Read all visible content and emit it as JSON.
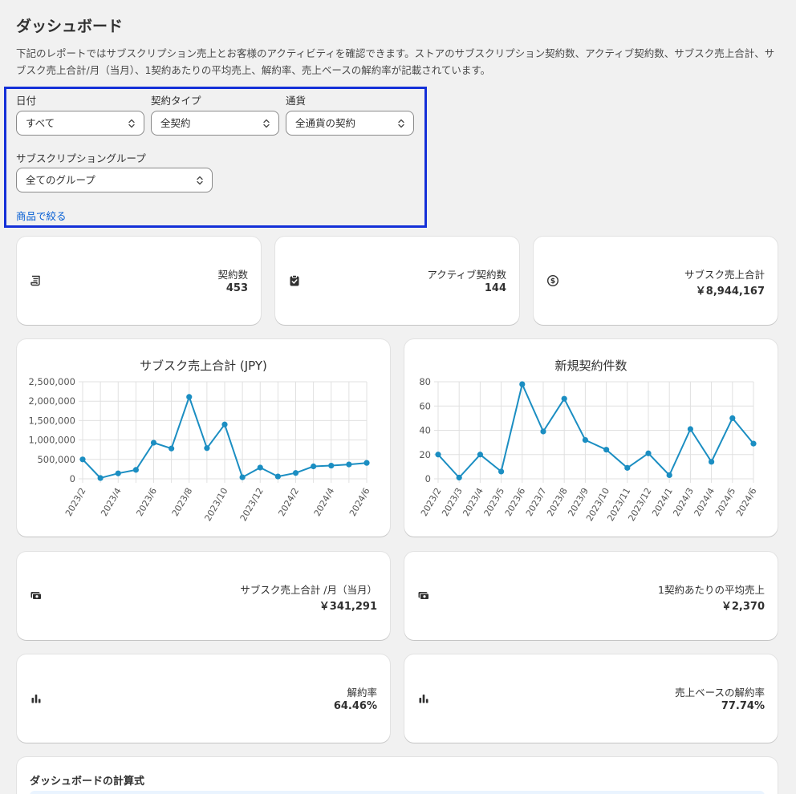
{
  "page": {
    "title": "ダッシュボード",
    "description": "下記のレポートではサブスクリプション売上とお客様のアクティビティを確認できます。ストアのサブスクリプション契約数、アクティブ契約数、サブスク売上合計、サブスク売上合計/月（当月）、1契約あたりの平均売上、解約率、売上ベースの解約率が記載されています。"
  },
  "filters": {
    "date": {
      "label": "日付",
      "value": "すべて"
    },
    "contract_type": {
      "label": "契約タイプ",
      "value": "全契約"
    },
    "currency": {
      "label": "通貨",
      "value": "全通貨の契約"
    },
    "group": {
      "label": "サブスクリプショングループ",
      "value": "全てのグループ"
    },
    "product_link": "商品で絞る"
  },
  "kpis": {
    "contracts": {
      "label": "契約数",
      "value": "453",
      "icon": "receipt-icon"
    },
    "active": {
      "label": "アクティブ契約数",
      "value": "144",
      "icon": "clipboard-check-icon"
    },
    "revenue_total": {
      "label": "サブスク売上合計",
      "value": "￥8,944,167",
      "icon": "dollar-circle-icon"
    },
    "monthly": {
      "label": "サブスク売上合計 /月（当月）",
      "value": "￥341,291",
      "icon": "cash-icon"
    },
    "avg": {
      "label": "1契約あたりの平均売上",
      "value": "￥2,370",
      "icon": "cash-icon"
    },
    "churn": {
      "label": "解約率",
      "value": "64.46%",
      "icon": "bar-chart-icon"
    },
    "revenue_churn": {
      "label": "売上ベースの解約率",
      "value": "77.74%",
      "icon": "bar-chart-icon"
    }
  },
  "formula": {
    "title": "ダッシュボードの計算式"
  },
  "colors": {
    "accent": "#1b8ec2",
    "link": "#005bd3",
    "highlight": "#1430d8"
  },
  "chart_data": [
    {
      "type": "line",
      "title": "サブスク売上合計 (JPY)",
      "x": [
        "2023/2",
        "2023/3",
        "2023/4",
        "2023/5",
        "2023/6",
        "2023/7",
        "2023/8",
        "2023/9",
        "2023/10",
        "2023/11",
        "2023/12",
        "2024/1",
        "2024/2",
        "2024/3",
        "2024/4",
        "2024/5",
        "2024/6"
      ],
      "x_tick_labels": [
        "2023/2",
        "2023/4",
        "2023/6",
        "2023/8",
        "2023/10",
        "2023/12",
        "2024/2",
        "2024/4",
        "2024/6"
      ],
      "values": [
        500000,
        20000,
        140000,
        230000,
        930000,
        780000,
        2110000,
        790000,
        1400000,
        40000,
        290000,
        60000,
        150000,
        320000,
        340000,
        370000,
        410000
      ],
      "y_ticks": [
        0,
        500000,
        1000000,
        1500000,
        2000000,
        2500000
      ],
      "y_tick_labels": [
        "0",
        "500,000",
        "1,000,000",
        "1,500,000",
        "2,000,000",
        "2,500,000"
      ],
      "ylim": [
        0,
        2500000
      ],
      "grid": true
    },
    {
      "type": "line",
      "title": "新規契約件数",
      "x": [
        "2023/2",
        "2023/3",
        "2023/4",
        "2023/5",
        "2023/6",
        "2023/7",
        "2023/8",
        "2023/9",
        "2023/10",
        "2023/11",
        "2023/12",
        "2024/1",
        "2024/3",
        "2024/4",
        "2024/5",
        "2024/6"
      ],
      "x_tick_labels": [
        "2023/2",
        "2023/3",
        "2023/4",
        "2023/5",
        "2023/6",
        "2023/7",
        "2023/8",
        "2023/9",
        "2023/10",
        "2023/11",
        "2023/12",
        "2024/1",
        "2024/3",
        "2024/4",
        "2024/5",
        "2024/6"
      ],
      "values": [
        20,
        1,
        20,
        6,
        78,
        39,
        66,
        32,
        24,
        9,
        21,
        3,
        41,
        14,
        50,
        29
      ],
      "y_ticks": [
        0,
        20,
        40,
        60,
        80
      ],
      "y_tick_labels": [
        "0",
        "20",
        "40",
        "60",
        "80"
      ],
      "ylim": [
        0,
        80
      ],
      "grid": true
    }
  ]
}
